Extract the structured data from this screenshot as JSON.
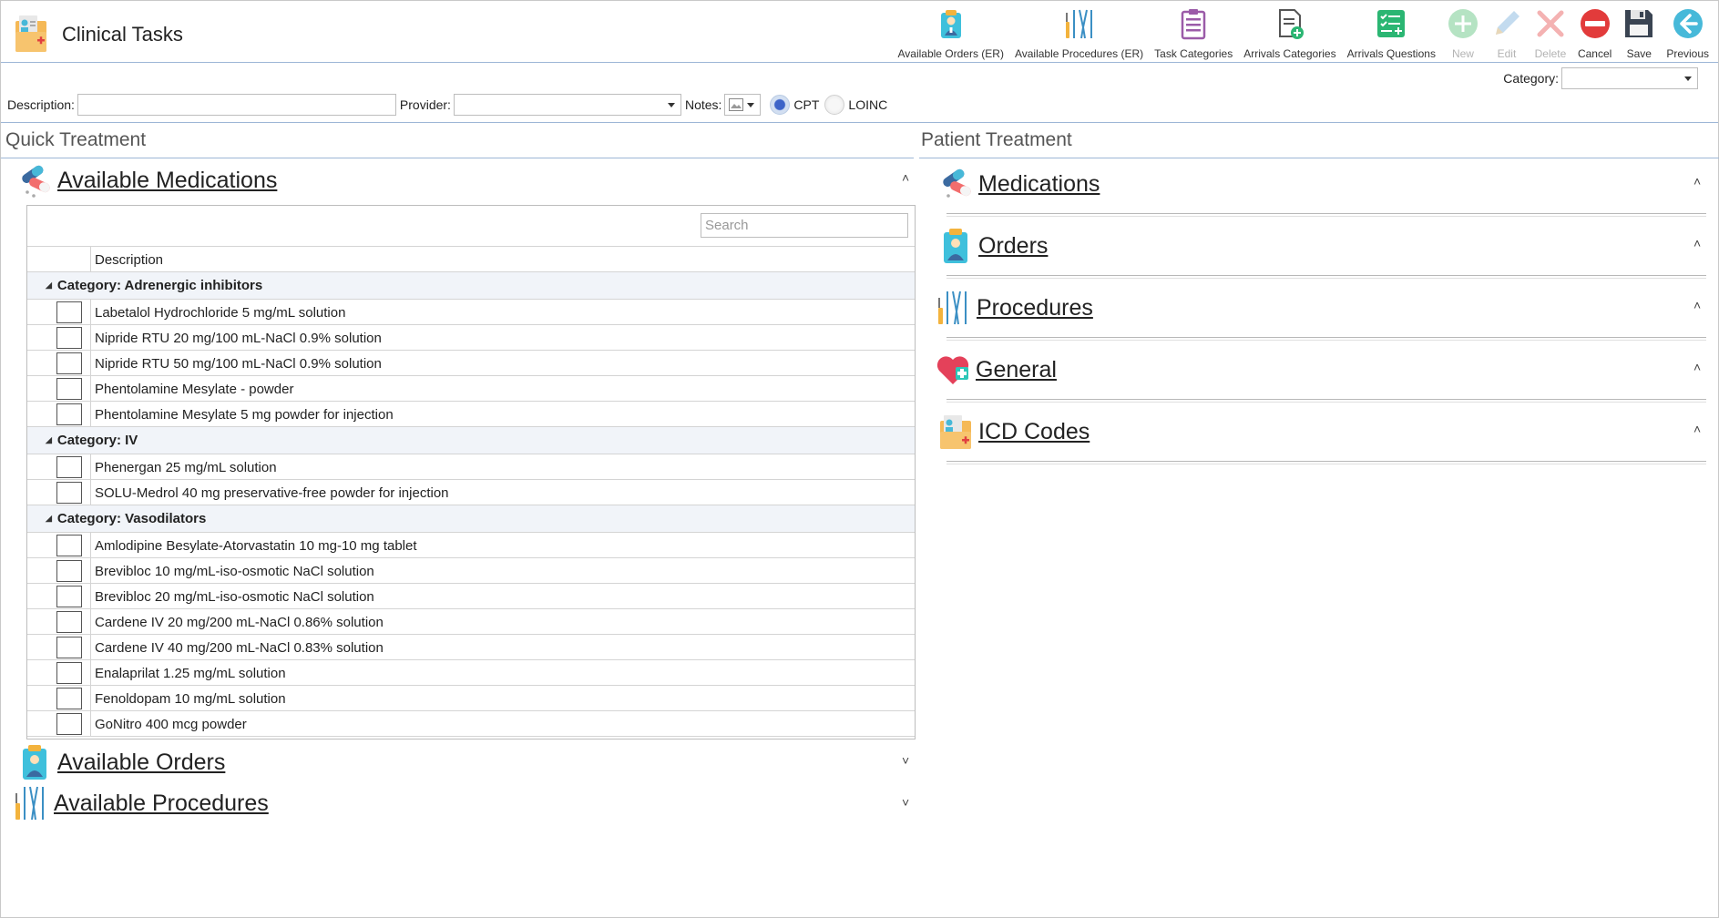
{
  "app": {
    "title": "Clinical Tasks"
  },
  "toolbar": {
    "items": [
      {
        "label": "Available Orders (ER)",
        "icon": "clipboard-doctor-icon",
        "enabled": true
      },
      {
        "label": "Available Procedures (ER)",
        "icon": "surgical-tools-icon",
        "enabled": true
      },
      {
        "label": "Task Categories",
        "icon": "checklist-icon",
        "enabled": true
      },
      {
        "label": "Arrivals Categories",
        "icon": "document-add-icon",
        "enabled": true
      },
      {
        "label": "Arrivals Questions",
        "icon": "list-add-icon",
        "enabled": true
      },
      {
        "label": "New",
        "icon": "plus-icon",
        "enabled": false
      },
      {
        "label": "Edit",
        "icon": "pencil-icon",
        "enabled": false
      },
      {
        "label": "Delete",
        "icon": "x-icon",
        "enabled": false
      },
      {
        "label": "Cancel",
        "icon": "no-entry-icon",
        "enabled": true
      },
      {
        "label": "Save",
        "icon": "floppy-disk-icon",
        "enabled": true
      },
      {
        "label": "Previous",
        "icon": "arrow-left-icon",
        "enabled": true
      }
    ]
  },
  "filters": {
    "category_label": "Category:",
    "category_value": "",
    "description_label": "Description:",
    "description_value": "",
    "provider_label": "Provider:",
    "provider_value": "",
    "notes_label": "Notes:",
    "code_options": [
      {
        "label": "CPT",
        "selected": true
      },
      {
        "label": "LOINC",
        "selected": false
      }
    ]
  },
  "quick_treatment": {
    "title": "Quick Treatment",
    "medications": {
      "label": "Available Medications",
      "search_placeholder": "Search",
      "column_header": "Description",
      "categories": [
        {
          "name": "Category: Adrenergic inhibitors",
          "items": [
            "Labetalol Hydrochloride 5 mg/mL solution",
            "Nipride RTU 20 mg/100 mL-NaCl 0.9% solution",
            "Nipride RTU 50 mg/100 mL-NaCl 0.9% solution",
            "Phentolamine Mesylate - powder",
            "Phentolamine Mesylate 5 mg powder for injection"
          ]
        },
        {
          "name": "Category: IV",
          "items": [
            "Phenergan 25 mg/mL solution",
            "SOLU-Medrol 40 mg preservative-free powder for injection"
          ]
        },
        {
          "name": "Category: Vasodilators",
          "items": [
            "Amlodipine Besylate-Atorvastatin 10 mg-10 mg tablet",
            "Brevibloc 10 mg/mL-iso-osmotic NaCl solution",
            "Brevibloc 20 mg/mL-iso-osmotic NaCl solution",
            "Cardene IV 20 mg/200 mL-NaCl 0.86% solution",
            "Cardene IV 40 mg/200 mL-NaCl 0.83% solution",
            "Enalaprilat 1.25 mg/mL solution",
            "Fenoldopam 10 mg/mL solution",
            "GoNitro 400 mcg powder"
          ]
        }
      ]
    },
    "orders": {
      "label": "Available Orders"
    },
    "procedures": {
      "label": "Available Procedures"
    }
  },
  "patient_treatment": {
    "title": "Patient Treatment",
    "groups": [
      {
        "label": "Medications",
        "icon": "pills-icon"
      },
      {
        "label": "Orders",
        "icon": "clipboard-doctor-icon"
      },
      {
        "label": "Procedures",
        "icon": "surgical-tools-icon"
      },
      {
        "label": "General",
        "icon": "heart-plus-icon"
      },
      {
        "label": "ICD Codes",
        "icon": "medical-folder-icon"
      }
    ]
  }
}
